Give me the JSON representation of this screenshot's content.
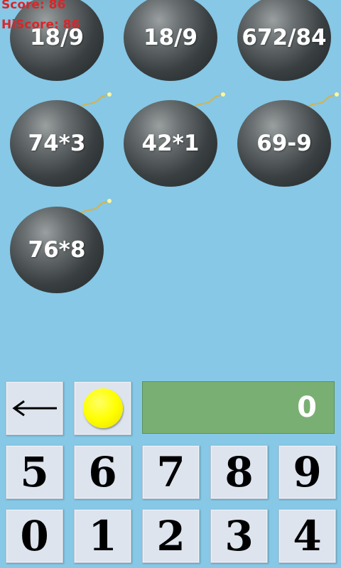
{
  "score_line": "Score: 86",
  "hiscore_line": "HiScore: 86",
  "bombs": [
    "18/9",
    "18/9",
    "672/84",
    "74*3",
    "42*1",
    "69-9",
    "76*8"
  ],
  "answer_display": "0",
  "keypad": {
    "backspace_icon": "left-arrow-icon",
    "clear_icon": "yellow-dot-icon",
    "row1": [
      "5",
      "6",
      "7",
      "8",
      "9"
    ],
    "row2": [
      "0",
      "1",
      "2",
      "3",
      "4"
    ]
  },
  "colors": {
    "background": "#86c8e6",
    "score_text": "#d7262a",
    "answer_panel": "#7aaf73",
    "key_face": "#dde4ee",
    "clear_dot": "#ffff00"
  }
}
